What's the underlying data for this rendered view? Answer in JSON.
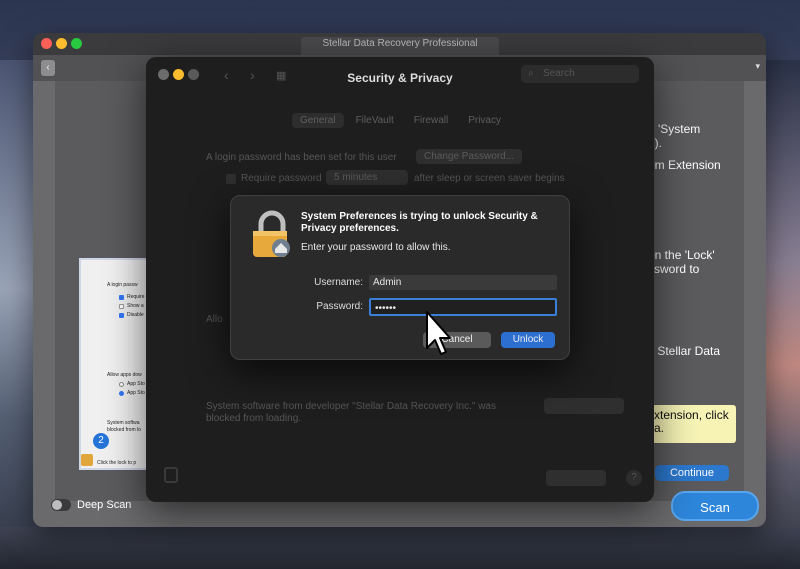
{
  "stellar": {
    "title": "Stellar Data Recovery Professional",
    "menu_arrow": "▾",
    "right_texts": [
      "d 'System",
      "1).",
      "em Extension",
      "on the 'Lock'",
      "ssword to",
      "y Stellar Data"
    ],
    "tip": "xtension, click a.",
    "continue_label": "Continue",
    "deep_scan_label": "Deep Scan",
    "scan_label": "Scan",
    "step_badge": "2",
    "thumb": {
      "login": "A login passw",
      "require": "Require",
      "show": "Show a",
      "disable": "Disable",
      "allow": "Allow apps dow",
      "app1": "App Sto",
      "app2": "App Sto",
      "system1": "System softwa",
      "system2": "blocked from lo",
      "lock": "Click the lock to p"
    }
  },
  "prefs": {
    "title": "Security & Privacy",
    "search_placeholder": "Search",
    "tabs": [
      "General",
      "FileVault",
      "Firewall",
      "Privacy"
    ],
    "login_text": "A login password has been set for this user",
    "change_password": "Change Password...",
    "require_password": "Require password",
    "require_delay": "5 minutes",
    "after_sleep": "after sleep or screen saver begins",
    "allow_text": "Allo",
    "system_software_1": "System software from developer \"Stellar Data Recovery Inc.\" was",
    "system_software_2": "blocked from loading."
  },
  "dialog": {
    "heading": "System Preferences is trying to unlock Security & Privacy preferences.",
    "subtext": "Enter your password to allow this.",
    "username_label": "Username:",
    "username_value": "Admin",
    "password_label": "Password:",
    "password_value": "••••••",
    "cancel_label": "Cancel",
    "unlock_label": "Unlock"
  }
}
